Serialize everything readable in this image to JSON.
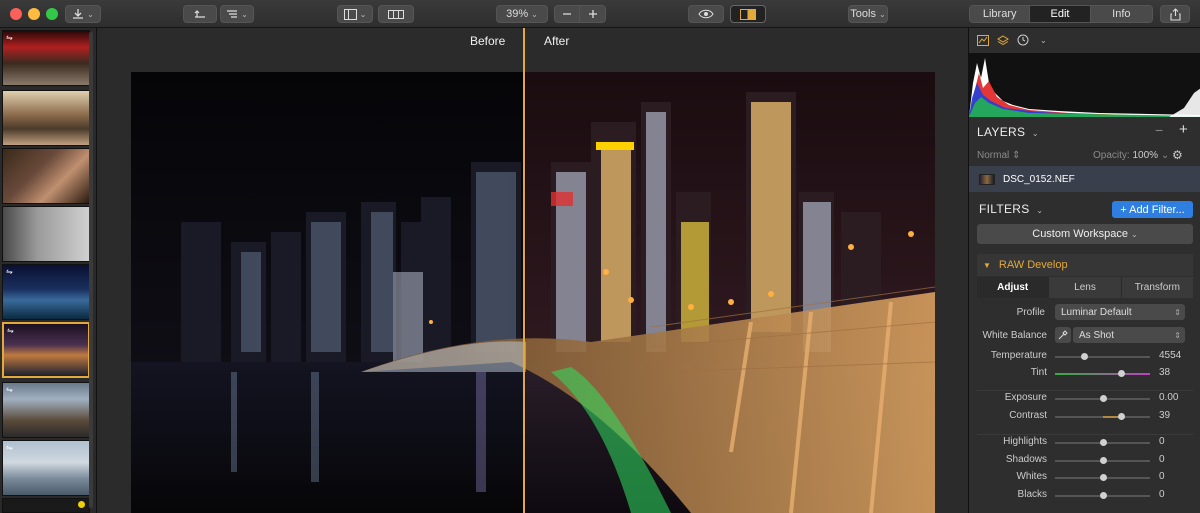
{
  "toolbar": {
    "zoom": "39%",
    "tools_label": "Tools",
    "tabs": [
      {
        "label": "Library"
      },
      {
        "label": "Edit"
      },
      {
        "label": "Info"
      }
    ]
  },
  "compare": {
    "before_label": "Before",
    "after_label": "After"
  },
  "layers": {
    "title": "LAYERS",
    "blend_mode": "Normal",
    "opacity_label": "Opacity:",
    "opacity_value": "100%",
    "layer_name": "DSC_0152.NEF"
  },
  "filters": {
    "title": "FILTERS",
    "add_filter_label": "+ Add Filter...",
    "workspace_label": "Custom Workspace"
  },
  "raw_develop": {
    "title": "RAW Develop",
    "tabs": [
      {
        "label": "Adjust"
      },
      {
        "label": "Lens"
      },
      {
        "label": "Transform"
      }
    ],
    "profile_label": "Profile",
    "profile_value": "Luminar Default",
    "white_balance_label": "White Balance",
    "white_balance_value": "As Shot",
    "sliders": [
      {
        "label": "Temperature",
        "value": "4554",
        "position": 0.3
      },
      {
        "label": "Tint",
        "value": "38",
        "position": 0.69
      },
      {
        "label": "Exposure",
        "value": "0.00",
        "position": 0.5
      },
      {
        "label": "Contrast",
        "value": "39",
        "position": 0.69
      },
      {
        "label": "Highlights",
        "value": "0",
        "position": 0.5
      },
      {
        "label": "Shadows",
        "value": "0",
        "position": 0.5
      },
      {
        "label": "Whites",
        "value": "0",
        "position": 0.5
      },
      {
        "label": "Blacks",
        "value": "0",
        "position": 0.5
      }
    ]
  },
  "colors": {
    "accent": "#e3a93a",
    "button_blue": "#2f7fe0"
  }
}
